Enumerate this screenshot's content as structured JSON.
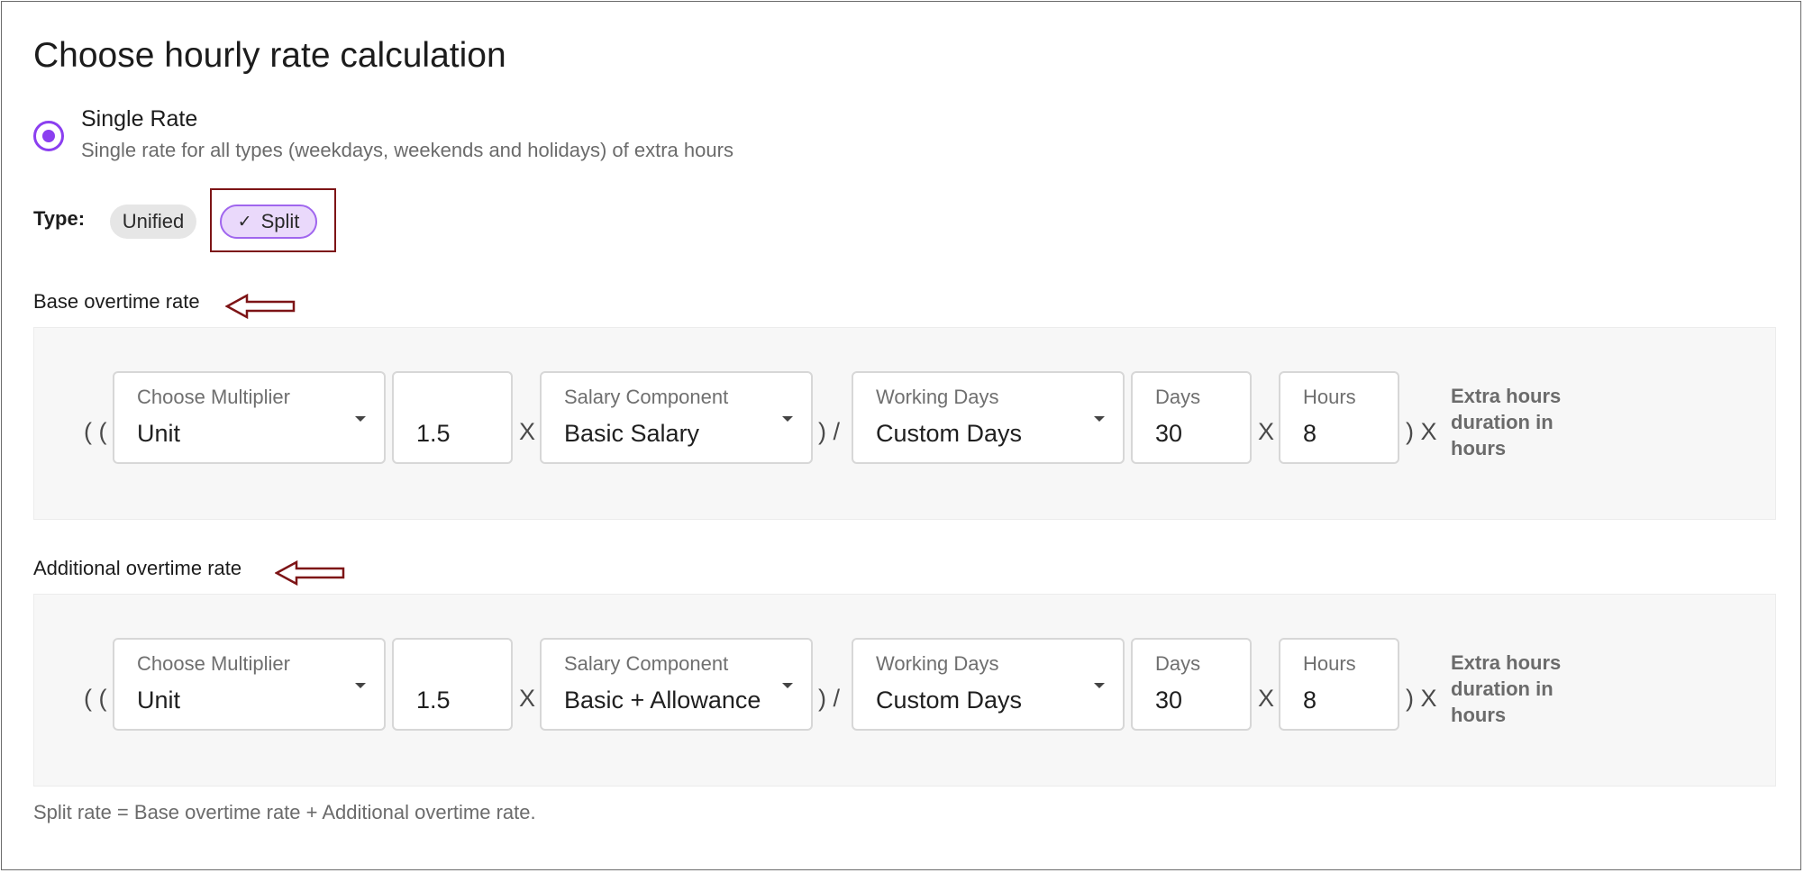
{
  "page": {
    "title": "Choose hourly rate calculation"
  },
  "rate_option": {
    "title": "Single Rate",
    "description": "Single rate for all types (weekdays, weekends and holidays) of extra hours",
    "selected": true,
    "accent": "#8b3ff0"
  },
  "type": {
    "label": "Type:",
    "chips": [
      {
        "label": "Unified",
        "selected": false
      },
      {
        "label": "Split",
        "selected": true,
        "icon": "check-icon"
      }
    ],
    "highlight_color": "#7d1416"
  },
  "sections": [
    {
      "label": "Base overtime rate",
      "open_paren": "( (",
      "multiplier": {
        "label": "Choose Multiplier",
        "value": "Unit"
      },
      "multiplier_value": "1.5",
      "op_times_1": "X",
      "salary_component": {
        "label": "Salary Component",
        "value": "Basic Salary"
      },
      "op_divide": ") /",
      "working_days": {
        "label": "Working Days",
        "value": "Custom Days"
      },
      "days": {
        "label": "Days",
        "value": "30"
      },
      "op_times_2": "X",
      "hours": {
        "label": "Hours",
        "value": "8"
      },
      "op_close": ") X",
      "suffix": "Extra hours duration in hours"
    },
    {
      "label": "Additional overtime rate",
      "open_paren": "( (",
      "multiplier": {
        "label": "Choose Multiplier",
        "value": "Unit"
      },
      "multiplier_value": "1.5",
      "op_times_1": "X",
      "salary_component": {
        "label": "Salary Component",
        "value": "Basic + Allowance"
      },
      "op_divide": ") /",
      "working_days": {
        "label": "Working Days",
        "value": "Custom Days"
      },
      "days": {
        "label": "Days",
        "value": "30"
      },
      "op_times_2": "X",
      "hours": {
        "label": "Hours",
        "value": "8"
      },
      "op_close": ") X",
      "suffix": "Extra hours duration in hours"
    }
  ],
  "footnote": "Split rate = Base overtime rate + Additional overtime rate."
}
